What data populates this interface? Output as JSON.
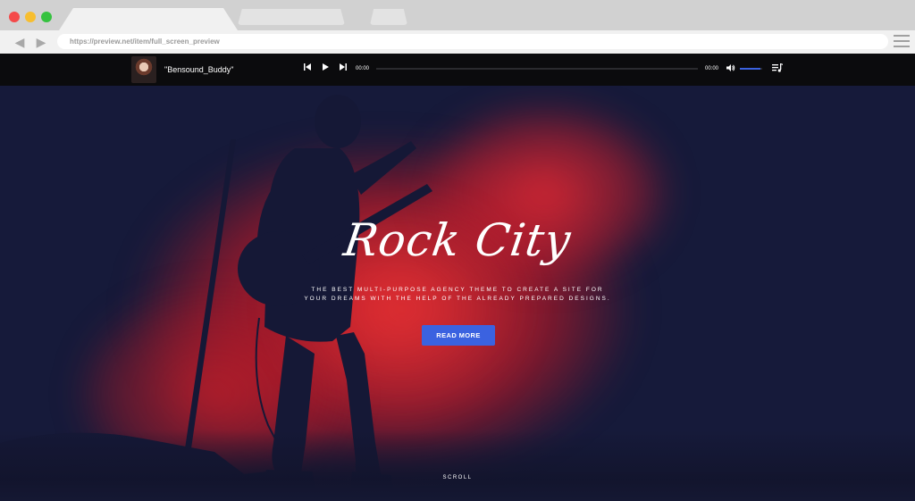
{
  "browser": {
    "url": "https://preview.net/item/full_screen_preview"
  },
  "player": {
    "track_title": "\"Bensound_Buddy\"",
    "current_time": "00:00",
    "duration": "00:00",
    "progress": 0,
    "volume": 0.9,
    "accent_color": "#3b62e0"
  },
  "hero": {
    "title": "Rock City",
    "subtitle": "THE BEST MULTI-PURPOSE AGENCY THEME TO CREATE A SITE FOR YOUR DREAMS WITH THE HELP OF THE ALREADY PREPARED DESIGNS.",
    "cta_label": "READ MORE",
    "scroll_label": "SCROLL",
    "background_color": "#161a3a",
    "smoke_color": "#d21e28"
  },
  "icons": {
    "prev": "skip-previous-icon",
    "play": "play-icon",
    "next": "skip-next-icon",
    "volume": "volume-icon",
    "playlist": "playlist-icon",
    "back": "back-arrow-icon",
    "forward": "forward-arrow-icon",
    "menu": "hamburger-menu-icon"
  }
}
